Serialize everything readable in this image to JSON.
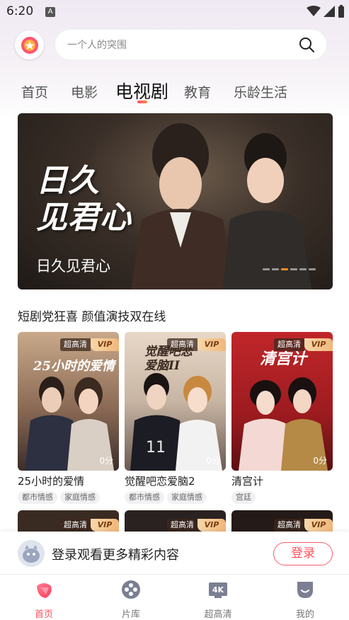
{
  "status": {
    "time": "6:20",
    "notif": "A"
  },
  "search": {
    "placeholder": "一个人的突围"
  },
  "tabs": [
    {
      "label": "首页"
    },
    {
      "label": "电影"
    },
    {
      "label": "电视剧"
    },
    {
      "label": "教育"
    },
    {
      "label": "乐龄生活"
    }
  ],
  "banner": {
    "art_title_line1": "日久",
    "art_title_line2": "见君心",
    "caption": "日久见君心",
    "dot_count": 6,
    "active_dot": 2
  },
  "section": {
    "title": "短剧党狂喜 颜值演技双在线"
  },
  "cards": [
    {
      "title": "25小时的爱情",
      "score": "0分",
      "art": "25小时的爱情",
      "tags": [
        "都市情感",
        "家庭情感"
      ],
      "hd": "超高清",
      "vip": "VIP"
    },
    {
      "title": "觉醒吧恋爱脑2",
      "score": "0分",
      "art": "觉醒吧恋爱脑II",
      "tags": [
        "都市情感",
        "家庭情感"
      ],
      "hd": "超高清",
      "vip": "VIP"
    },
    {
      "title": "清宫计",
      "score": "0分",
      "art": "清宫计",
      "tags": [
        "宫廷"
      ],
      "hd": "超高清",
      "vip": "VIP"
    }
  ],
  "row2_badges": {
    "hd": "超高清",
    "vip": "VIP"
  },
  "login": {
    "text": "登录观看更多精彩内容",
    "button": "登录"
  },
  "nav": [
    {
      "label": "首页",
      "icon": "home-icon",
      "active": true
    },
    {
      "label": "片库",
      "icon": "library-icon",
      "active": false
    },
    {
      "label": "超高清",
      "icon": "4k-icon",
      "active": false
    },
    {
      "label": "我的",
      "icon": "profile-icon",
      "active": false
    }
  ],
  "colors": {
    "accent": "#ff4f5a",
    "vip_gold": "#f0b77a"
  }
}
